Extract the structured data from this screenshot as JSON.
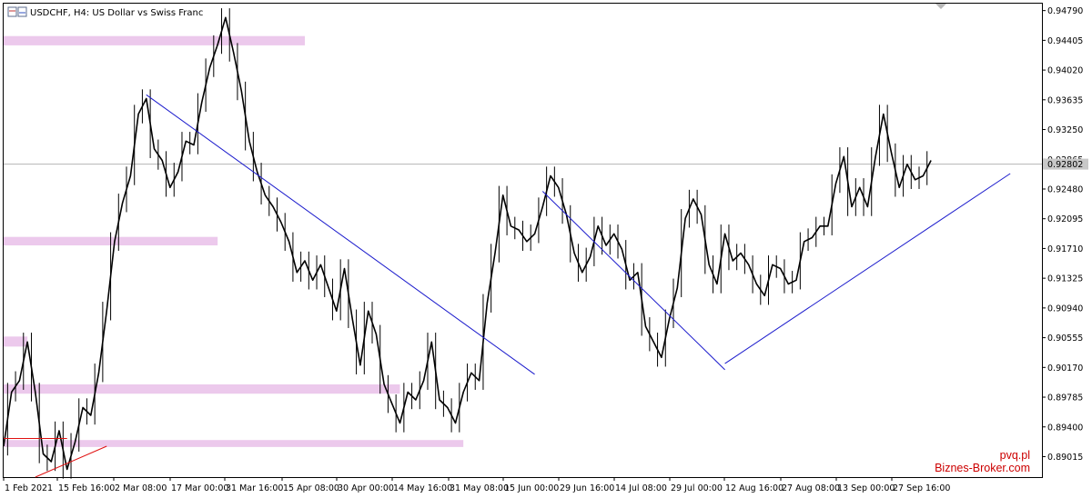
{
  "header": {
    "title": "USDCHF, H4:  US Dollar vs Swiss Franc",
    "icon": "chart-window-icon"
  },
  "watermark": {
    "line1": "pvq.pl",
    "line2": "Biznes-Broker.com"
  },
  "colors": {
    "candles": "#000000",
    "trendline": "#1a1acc",
    "support_line": "#e01010",
    "zones": "#ecc9ec",
    "current_price_line": "#b4b4b4"
  },
  "chart_data": {
    "type": "line",
    "symbol": "USDCHF",
    "timeframe": "H4",
    "grid": false,
    "ylim": [
      0.8875,
      0.9488
    ],
    "y_ticks": [
      "0.94790",
      "0.94405",
      "0.94020",
      "0.93635",
      "0.93250",
      "0.92865",
      "0.92480",
      "0.92095",
      "0.91710",
      "0.91325",
      "0.90940",
      "0.90555",
      "0.90170",
      "0.89785",
      "0.89400",
      "0.89015"
    ],
    "x_ticks": [
      "1 Feb 2021",
      "15 Feb 16:00",
      "2 Mar 08:00",
      "17 Mar 00:00",
      "31 Mar 16:00",
      "15 Apr 08:00",
      "30 Apr 00:00",
      "14 May 16:00",
      "31 May 08:00",
      "15 Jun 00:00",
      "29 Jun 16:00",
      "14 Jul 08:00",
      "29 Jul 00:00",
      "12 Aug 16:00",
      "27 Aug 08:00",
      "13 Sep 00:00",
      "27 Sep 16:00"
    ],
    "current_price": 0.92802,
    "current_price_label": "0.92802",
    "price_path": [
      [
        0,
        0.8915
      ],
      [
        1,
        0.8985
      ],
      [
        2,
        0.9
      ],
      [
        3,
        0.905
      ],
      [
        4,
        0.8985
      ],
      [
        5,
        0.8905
      ],
      [
        6,
        0.8895
      ],
      [
        7,
        0.8935
      ],
      [
        8,
        0.8885
      ],
      [
        9,
        0.892
      ],
      [
        10,
        0.8965
      ],
      [
        11,
        0.8955
      ],
      [
        12,
        0.901
      ],
      [
        13,
        0.909
      ],
      [
        14,
        0.918
      ],
      [
        15,
        0.923
      ],
      [
        16,
        0.9265
      ],
      [
        17,
        0.9345
      ],
      [
        18,
        0.9365
      ],
      [
        19,
        0.93
      ],
      [
        20,
        0.9285
      ],
      [
        21,
        0.925
      ],
      [
        22,
        0.927
      ],
      [
        23,
        0.931
      ],
      [
        24,
        0.9305
      ],
      [
        25,
        0.936
      ],
      [
        26,
        0.9405
      ],
      [
        27,
        0.9435
      ],
      [
        28,
        0.947
      ],
      [
        29,
        0.9425
      ],
      [
        30,
        0.9375
      ],
      [
        31,
        0.931
      ],
      [
        32,
        0.927
      ],
      [
        33,
        0.924
      ],
      [
        34,
        0.9225
      ],
      [
        35,
        0.9205
      ],
      [
        36,
        0.918
      ],
      [
        37,
        0.914
      ],
      [
        38,
        0.9155
      ],
      [
        39,
        0.913
      ],
      [
        40,
        0.915
      ],
      [
        41,
        0.912
      ],
      [
        42,
        0.909
      ],
      [
        43,
        0.9145
      ],
      [
        44,
        0.908
      ],
      [
        45,
        0.902
      ],
      [
        46,
        0.909
      ],
      [
        47,
        0.906
      ],
      [
        48,
        0.8995
      ],
      [
        49,
        0.897
      ],
      [
        50,
        0.8945
      ],
      [
        51,
        0.8985
      ],
      [
        52,
        0.8975
      ],
      [
        53,
        0.9
      ],
      [
        54,
        0.905
      ],
      [
        55,
        0.8975
      ],
      [
        56,
        0.8965
      ],
      [
        57,
        0.8945
      ],
      [
        58,
        0.8985
      ],
      [
        59,
        0.901
      ],
      [
        60,
        0.9
      ],
      [
        61,
        0.91
      ],
      [
        62,
        0.9165
      ],
      [
        63,
        0.924
      ],
      [
        64,
        0.92
      ],
      [
        65,
        0.9195
      ],
      [
        66,
        0.918
      ],
      [
        67,
        0.919
      ],
      [
        68,
        0.9225
      ],
      [
        69,
        0.9265
      ],
      [
        70,
        0.925
      ],
      [
        71,
        0.9215
      ],
      [
        72,
        0.9165
      ],
      [
        73,
        0.914
      ],
      [
        74,
        0.916
      ],
      [
        75,
        0.92
      ],
      [
        76,
        0.9175
      ],
      [
        77,
        0.919
      ],
      [
        78,
        0.917
      ],
      [
        79,
        0.913
      ],
      [
        80,
        0.914
      ],
      [
        81,
        0.907
      ],
      [
        82,
        0.905
      ],
      [
        83,
        0.903
      ],
      [
        84,
        0.908
      ],
      [
        85,
        0.912
      ],
      [
        86,
        0.921
      ],
      [
        87,
        0.9235
      ],
      [
        88,
        0.9215
      ],
      [
        89,
        0.915
      ],
      [
        90,
        0.9125
      ],
      [
        91,
        0.919
      ],
      [
        92,
        0.9155
      ],
      [
        93,
        0.9165
      ],
      [
        94,
        0.915
      ],
      [
        95,
        0.9125
      ],
      [
        96,
        0.911
      ],
      [
        97,
        0.915
      ],
      [
        98,
        0.9145
      ],
      [
        99,
        0.9125
      ],
      [
        100,
        0.913
      ],
      [
        101,
        0.918
      ],
      [
        102,
        0.9185
      ],
      [
        103,
        0.92
      ],
      [
        104,
        0.92
      ],
      [
        105,
        0.9255
      ],
      [
        106,
        0.929
      ],
      [
        107,
        0.9225
      ],
      [
        108,
        0.925
      ],
      [
        109,
        0.9225
      ],
      [
        110,
        0.929
      ],
      [
        111,
        0.9345
      ],
      [
        112,
        0.9295
      ],
      [
        113,
        0.925
      ],
      [
        114,
        0.928
      ],
      [
        115,
        0.926
      ],
      [
        116,
        0.9265
      ],
      [
        117,
        0.9285
      ]
    ],
    "trendlines": [
      {
        "color": "#1a1acc",
        "from": [
          18,
          0.937
        ],
        "to": [
          67,
          0.9008
        ]
      },
      {
        "color": "#1a1acc",
        "from": [
          68,
          0.9245
        ],
        "to": [
          91,
          0.9014
        ]
      },
      {
        "color": "#1a1acc",
        "from": [
          91,
          0.9022
        ],
        "to": [
          127,
          0.9268
        ]
      },
      {
        "color": "#e01010",
        "from": [
          4,
          0.8875
        ],
        "to": [
          13,
          0.8915
        ]
      },
      {
        "color": "#e01010",
        "from": [
          0,
          0.8925
        ],
        "to": [
          8,
          0.8925
        ]
      }
    ],
    "zones": [
      {
        "y0": 0.9434,
        "y1": 0.9446,
        "x_end": 38
      },
      {
        "y0": 0.9175,
        "y1": 0.9186,
        "x_end": 27
      },
      {
        "y0": 0.9044,
        "y1": 0.9057,
        "x_end": 3
      },
      {
        "y0": 0.8983,
        "y1": 0.8995,
        "x_end": 50
      },
      {
        "y0": 0.8914,
        "y1": 0.8923,
        "x_end": 58
      }
    ]
  }
}
